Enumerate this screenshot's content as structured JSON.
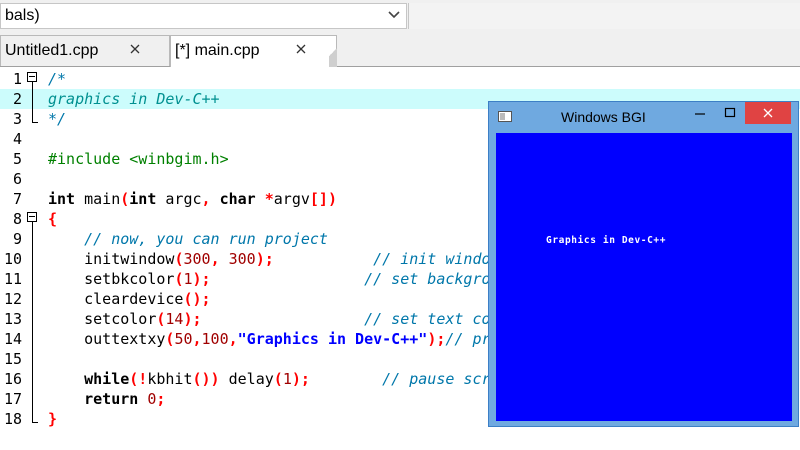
{
  "toolbar": {
    "combo_value": "bals)"
  },
  "tabs": [
    {
      "label": "Untitled1.cpp",
      "active": false
    },
    {
      "label": "[*] main.cpp",
      "active": true
    }
  ],
  "editor": {
    "highlighted_line": 2,
    "lines": [
      {
        "n": "1",
        "tokens": [
          [
            "cm",
            "/*"
          ]
        ]
      },
      {
        "n": "2",
        "tokens": [
          [
            "cmh",
            "graphics in Dev-C++"
          ]
        ]
      },
      {
        "n": "3",
        "tokens": [
          [
            "cm",
            "*/"
          ]
        ]
      },
      {
        "n": "4",
        "tokens": []
      },
      {
        "n": "5",
        "tokens": [
          [
            "pp",
            "#include <winbgim.h>"
          ]
        ]
      },
      {
        "n": "6",
        "tokens": []
      },
      {
        "n": "7",
        "tokens": [
          [
            "kw",
            "int"
          ],
          [
            "",
            " main"
          ],
          [
            "sym",
            "("
          ],
          [
            "kw",
            "int"
          ],
          [
            "",
            " argc"
          ],
          [
            "sym",
            ","
          ],
          [
            "",
            " "
          ],
          [
            "kw",
            "char"
          ],
          [
            "",
            " "
          ],
          [
            "sym",
            "*"
          ],
          [
            "",
            "argv"
          ],
          [
            "sym",
            "[])"
          ]
        ]
      },
      {
        "n": "8",
        "tokens": [
          [
            "sym",
            "{"
          ]
        ]
      },
      {
        "n": "9",
        "tokens": [
          [
            "",
            "    "
          ],
          [
            "cm",
            "// now, you can run project"
          ]
        ]
      },
      {
        "n": "10",
        "tokens": [
          [
            "",
            "    initwindow"
          ],
          [
            "sym",
            "("
          ],
          [
            "num",
            "300"
          ],
          [
            "sym",
            ","
          ],
          [
            "",
            " "
          ],
          [
            "num",
            "300"
          ],
          [
            "sym",
            ");"
          ],
          [
            "",
            "           "
          ],
          [
            "cm",
            "// init window"
          ]
        ]
      },
      {
        "n": "11",
        "tokens": [
          [
            "",
            "    setbkcolor"
          ],
          [
            "sym",
            "("
          ],
          [
            "num",
            "1"
          ],
          [
            "sym",
            ");"
          ],
          [
            "",
            "                 "
          ],
          [
            "cm",
            "// set background"
          ]
        ]
      },
      {
        "n": "12",
        "tokens": [
          [
            "",
            "    cleardevice"
          ],
          [
            "sym",
            "();"
          ]
        ]
      },
      {
        "n": "13",
        "tokens": [
          [
            "",
            "    setcolor"
          ],
          [
            "sym",
            "("
          ],
          [
            "num",
            "14"
          ],
          [
            "sym",
            ");"
          ],
          [
            "",
            "                  "
          ],
          [
            "cm",
            "// set text color"
          ]
        ]
      },
      {
        "n": "14",
        "tokens": [
          [
            "",
            "    outtextxy"
          ],
          [
            "sym",
            "("
          ],
          [
            "num",
            "50"
          ],
          [
            "sym",
            ","
          ],
          [
            "num",
            "100"
          ],
          [
            "sym",
            ","
          ],
          [
            "str",
            "\"Graphics in Dev-C++\""
          ],
          [
            "sym",
            ");"
          ],
          [
            "cm",
            "// print text"
          ]
        ]
      },
      {
        "n": "15",
        "tokens": []
      },
      {
        "n": "16",
        "tokens": [
          [
            "",
            "    "
          ],
          [
            "kw",
            "while"
          ],
          [
            "sym",
            "(!"
          ],
          [
            "",
            "kbhit"
          ],
          [
            "sym",
            "())"
          ],
          [
            "",
            " delay"
          ],
          [
            "sym",
            "("
          ],
          [
            "num",
            "1"
          ],
          [
            "sym",
            ");"
          ],
          [
            "",
            "        "
          ],
          [
            "cm",
            "// pause screen"
          ]
        ]
      },
      {
        "n": "17",
        "tokens": [
          [
            "",
            "    "
          ],
          [
            "kw",
            "return"
          ],
          [
            "",
            " "
          ],
          [
            "num",
            "0"
          ],
          [
            "sym",
            ";"
          ]
        ]
      },
      {
        "n": "18",
        "tokens": [
          [
            "sym",
            "}"
          ]
        ]
      }
    ]
  },
  "bgi_window": {
    "title": "Windows BGI",
    "text": "Graphics in Dev-C++",
    "background_color": "#0000ff",
    "icons": [
      "app-icon",
      "minimize-icon",
      "maximize-icon",
      "close-icon"
    ]
  },
  "colors": {
    "line_highlight": "#ccfcfc",
    "comment": "#0077aa",
    "preprocessor": "#008000",
    "number": "#a00000",
    "symbol": "#ff0000",
    "string": "#0000ff",
    "bgi_titlebar": "#6fa9e0",
    "bgi_close": "#e04343"
  }
}
